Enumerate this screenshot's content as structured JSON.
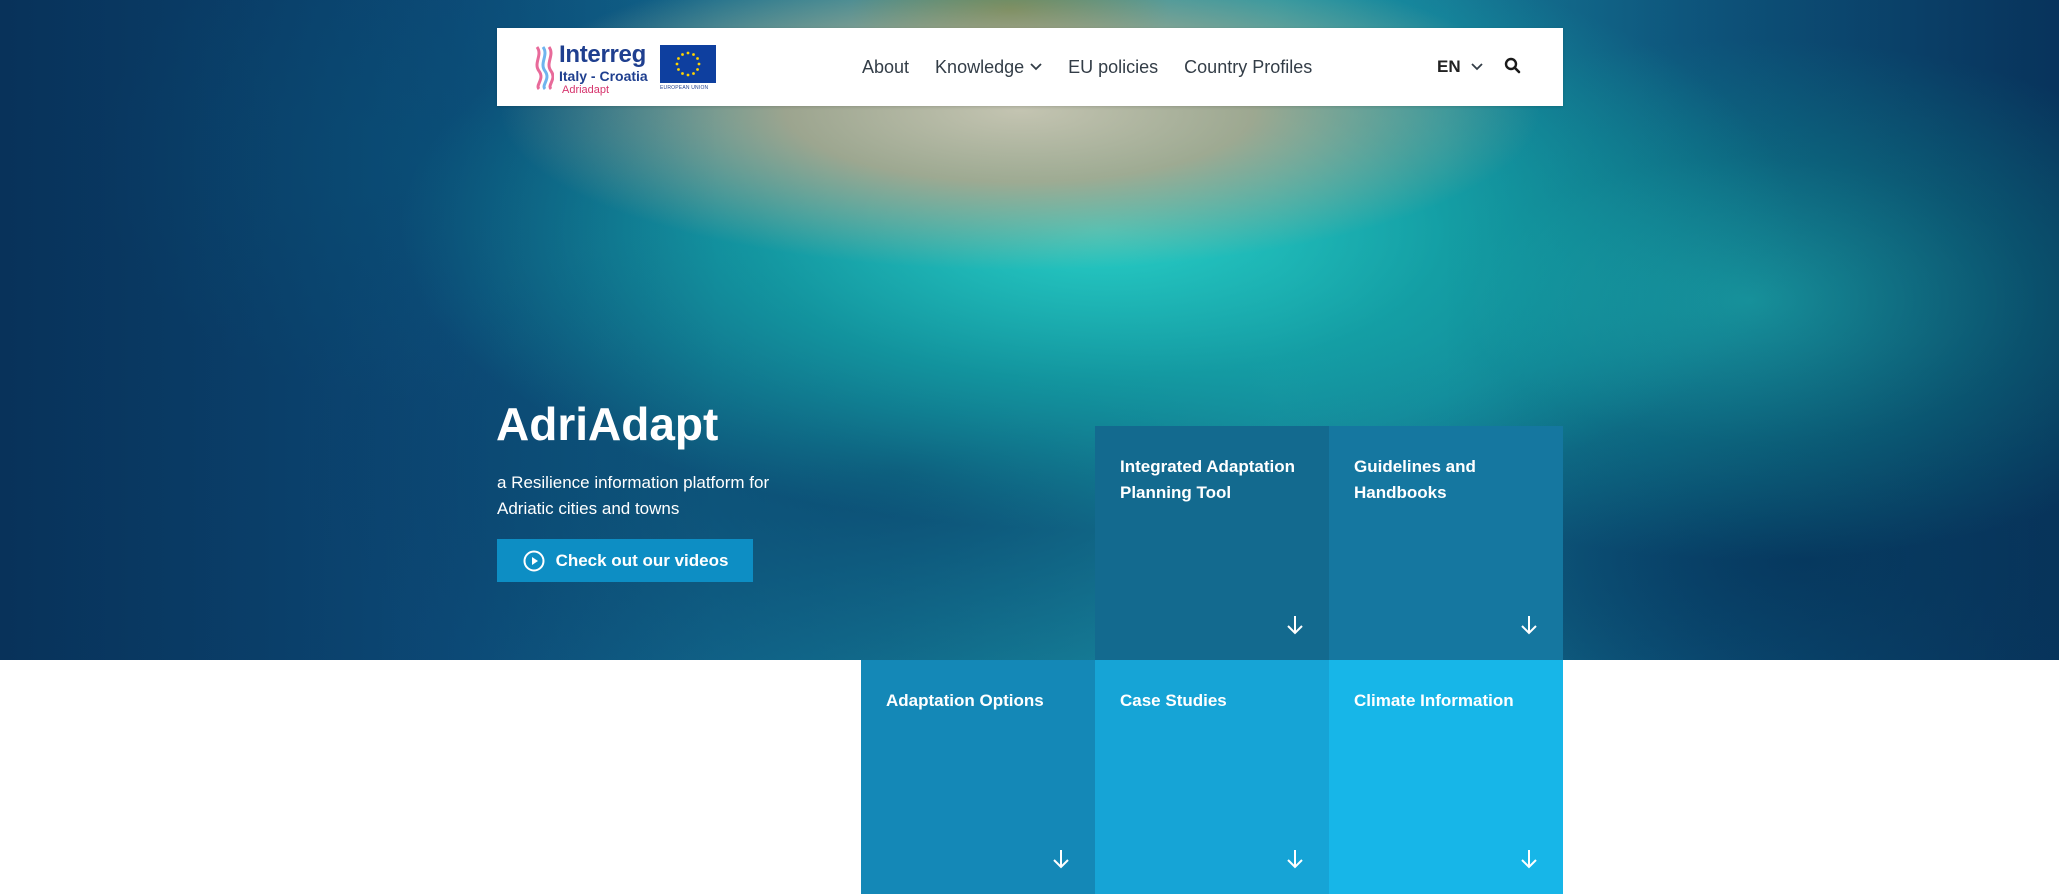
{
  "brand": {
    "logo_main": "Interreg",
    "logo_country": "Italy - Croatia",
    "logo_project": "Adriadapt",
    "eu_caption": "EUROPEAN UNION"
  },
  "nav": {
    "items": [
      {
        "label": "About",
        "has_dropdown": false
      },
      {
        "label": "Knowledge",
        "has_dropdown": true
      },
      {
        "label": "EU policies",
        "has_dropdown": false
      },
      {
        "label": "Country Profiles",
        "has_dropdown": false
      }
    ],
    "language": "EN",
    "search_icon": "search-icon"
  },
  "hero": {
    "title": "AdriAdapt",
    "subtitle": "a Resilience information platform for Adriatic cities and towns",
    "cta_label": "Check out our videos",
    "cta_icon": "play-circle-icon"
  },
  "tiles": [
    {
      "label": "Integrated Adaptation Planning Tool",
      "color": "#136a8f"
    },
    {
      "label": "Guidelines and Handbooks",
      "color": "#1577a0"
    },
    {
      "label": "Adaptation Options",
      "color": "#1488b7"
    },
    {
      "label": "Case Studies",
      "color": "#16a4d6"
    },
    {
      "label": "Climate Information",
      "color": "#17b6e8"
    }
  ],
  "colors": {
    "cta": "#0d8ec4",
    "nav_text": "#333d47",
    "logo_blue": "#1f3f8f",
    "logo_pink": "#d6336c"
  }
}
